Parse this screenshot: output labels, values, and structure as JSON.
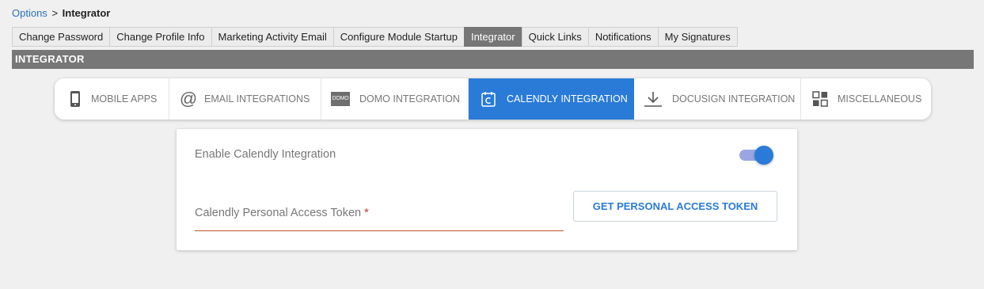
{
  "breadcrumb": {
    "parent": "Options",
    "separator": ">",
    "current": "Integrator"
  },
  "top_tabs": [
    {
      "label": "Change Password",
      "active": false
    },
    {
      "label": "Change Profile Info",
      "active": false
    },
    {
      "label": "Marketing Activity Email",
      "active": false
    },
    {
      "label": "Configure Module Startup",
      "active": false
    },
    {
      "label": "Integrator",
      "active": true
    },
    {
      "label": "Quick Links",
      "active": false
    },
    {
      "label": "Notifications",
      "active": false
    },
    {
      "label": "My Signatures",
      "active": false
    }
  ],
  "section_title": "INTEGRATOR",
  "sub_tabs": [
    {
      "label": "MOBILE APPS",
      "icon": "mobile-phone-icon",
      "active": false
    },
    {
      "label": "EMAIL INTEGRATIONS",
      "icon": "at-sign-icon",
      "active": false
    },
    {
      "label": "DOMO INTEGRATION",
      "icon": "domo-logo-icon",
      "icon_text": "DOMO",
      "active": false
    },
    {
      "label": "CALENDLY INTEGRATION",
      "icon": "calendly-icon",
      "active": true
    },
    {
      "label": "DOCUSIGN INTEGRATION",
      "icon": "download-icon",
      "active": false
    },
    {
      "label": "MISCELLANEOUS",
      "icon": "grid-icon",
      "active": false
    }
  ],
  "calendly": {
    "enable_label": "Enable Calendly Integration",
    "enabled": true,
    "token_label": "Calendly Personal Access Token",
    "required_marker": "*",
    "token_value": "",
    "get_token_button": "GET PERSONAL ACCESS TOKEN"
  },
  "colors": {
    "accent": "#2a7bd7",
    "active_top_tab": "#767676",
    "section_bar": "#777777",
    "toggle_track": "#9aa6e4",
    "required": "#c0392b",
    "field_underline": "#c0562a"
  }
}
